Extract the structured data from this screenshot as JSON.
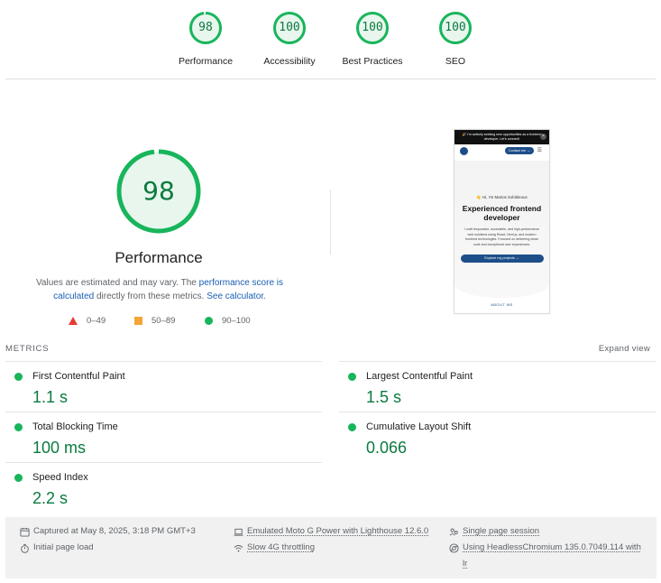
{
  "categories": [
    {
      "label": "Performance",
      "score": "98",
      "fraction": 0.98
    },
    {
      "label": "Accessibility",
      "score": "100",
      "fraction": 1.0
    },
    {
      "label": "Best Practices",
      "score": "100",
      "fraction": 1.0
    },
    {
      "label": "SEO",
      "score": "100",
      "fraction": 1.0
    }
  ],
  "main": {
    "score": "98",
    "fraction": 0.98,
    "title": "Performance",
    "desc_prefix": "Values are estimated and may vary. The ",
    "desc_link1": "performance score is calculated",
    "desc_middle": " directly from these metrics. ",
    "desc_link2": "See calculator",
    "desc_suffix": "."
  },
  "legend": [
    {
      "shape": "triangle",
      "range": "0–49",
      "color": "#e53935"
    },
    {
      "shape": "square",
      "range": "50–89",
      "color": "#f4a535"
    },
    {
      "shape": "circle",
      "range": "90–100",
      "color": "#18b55b"
    }
  ],
  "thumbnail": {
    "banner": "🎉 I'm actively seeking new opportunities as a frontend developer. Let's connect!",
    "contact": "Contact me →",
    "greeting": "👋 Hi, I'm Marios Sofokleous",
    "heading": "Experienced frontend developer",
    "paragraph": "I craft responsive, accessible, and high-performance web solutions using React, Next.js, and modern frontend technologies. Focused on delivering clean code and exceptional user experiences.",
    "cta": "Explore my projects →",
    "about": "ABOUT ME"
  },
  "metrics": {
    "header": "METRICS",
    "expand": "Expand view",
    "items": [
      {
        "name": "First Contentful Paint",
        "value": "1.1 s"
      },
      {
        "name": "Largest Contentful Paint",
        "value": "1.5 s"
      },
      {
        "name": "Total Blocking Time",
        "value": "100 ms"
      },
      {
        "name": "Cumulative Layout Shift",
        "value": "0.066"
      },
      {
        "name": "Speed Index",
        "value": "2.2 s"
      }
    ]
  },
  "footer": {
    "captured": "Captured at May 8, 2025, 3:18 PM GMT+3",
    "load": "Initial page load",
    "device": "Emulated Moto G Power with Lighthouse 12.6.0",
    "throttling": "Slow 4G throttling",
    "session": "Single page session",
    "browser_line1": "Using HeadlessChromium 135.0.7049.114 with",
    "browser_line2": "lr"
  },
  "colors": {
    "pass": "#0b7a3e",
    "pass_ring": "#18b55b",
    "pass_fill": "#e8f6ee",
    "link": "#1a5fb4"
  }
}
